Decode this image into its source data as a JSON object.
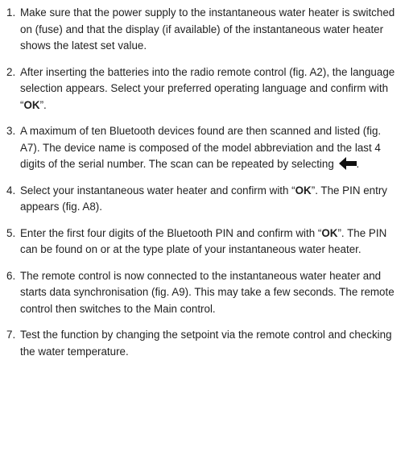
{
  "steps": [
    {
      "num": "1.",
      "text": "Make sure that the power supply to the instantaneous water heater is switched on (fuse) and that the display (if available) of the instantane­ous water heater shows the latest set value."
    },
    {
      "num": "2.",
      "pre": "After inserting the batteries into the radio remote control (fig. A2), the language selection appears. Select your preferred operating language and confirm with “",
      "bold": "OK",
      "post": "”."
    },
    {
      "num": "3.",
      "pre": "A maximum of ten Bluetooth devices found are then scanned and list­ed (fig. A7). The device name is composed of the model abbreviation and the last 4 digits of the serial number. The scan can be repeated by selecting",
      "icon": "back-arrow-icon",
      "post": "."
    },
    {
      "num": "4.",
      "pre": "Select your instantaneous water heater and confirm with “",
      "bold": "OK",
      "post": "”. The PIN entry appears (fig. A8)."
    },
    {
      "num": "5.",
      "pre": "Enter the first four digits of the Bluetooth PIN and confirm with “",
      "bold": "OK",
      "post": "”. The PIN can be found on or at the type plate of your instantaneous water heater."
    },
    {
      "num": "6.",
      "text": "The remote control is now connected to the instantaneous water heater and starts data synchronisation (fig. A9). This may take a few seconds. The remote control then switches to the Main control."
    },
    {
      "num": "7.",
      "text": "Test the function by changing the setpoint via the remote control and checking the water temperature."
    }
  ]
}
